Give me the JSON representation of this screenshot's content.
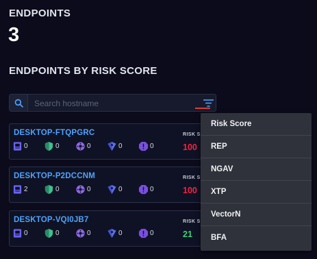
{
  "summary": {
    "title": "ENDPOINTS",
    "count": "3"
  },
  "section_title": "ENDPOINTS BY RISK SCORE",
  "search": {
    "placeholder": "Search hostname"
  },
  "risk_label": "RISK SCO",
  "colors": {
    "accent": "#4ea3ff",
    "high_risk": "#ff1f3d",
    "low_risk": "#3fd07a",
    "filter_active": "#e23a3a"
  },
  "endpoints": [
    {
      "hostname": "DESKTOP-FTQPGRC",
      "metrics": [
        "0",
        "0",
        "0",
        "0",
        "0"
      ],
      "risk_score": "100",
      "risk_level": "high"
    },
    {
      "hostname": "DESKTOP-P2DCCNM",
      "metrics": [
        "2",
        "0",
        "0",
        "0",
        "0"
      ],
      "risk_score": "100",
      "risk_level": "high"
    },
    {
      "hostname": "DESKTOP-VQI0JB7",
      "metrics": [
        "0",
        "0",
        "0",
        "0",
        "0"
      ],
      "risk_score": "21",
      "risk_level": "low"
    }
  ],
  "metric_icons": [
    "rep-icon",
    "ngav-icon",
    "xtp-icon",
    "vectorn-icon",
    "bfa-icon"
  ],
  "sort_menu": {
    "items": [
      "Risk Score",
      "REP",
      "NGAV",
      "XTP",
      "VectorN",
      "BFA"
    ]
  }
}
